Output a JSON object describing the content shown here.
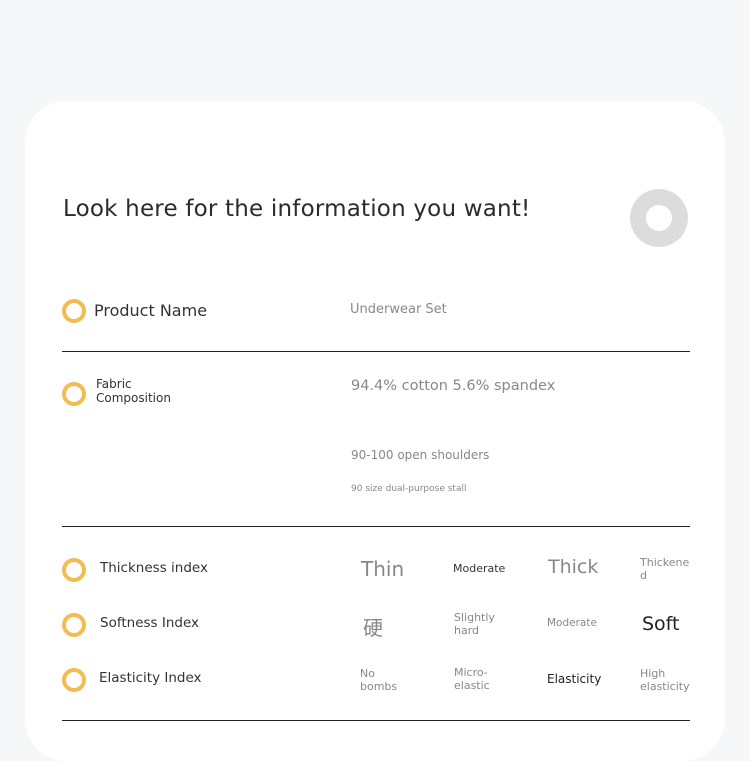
{
  "headline": "Look here for the information you want!",
  "rows": {
    "product_name": {
      "label": "Product Name",
      "value": "Underwear Set"
    },
    "fabric": {
      "label_line1": "Fabric",
      "label_line2": "Composition",
      "value": "94.4% cotton 5.6% spandex",
      "size_line": "90-100 open shoulders",
      "size_note": "90 size dual-purpose stall"
    }
  },
  "indices": {
    "thickness": {
      "label": "Thickness index",
      "levels": {
        "l1": "Thin",
        "l2": "Moderate",
        "l3": "Thick",
        "l4a": "Thickene",
        "l4b": "d"
      }
    },
    "softness": {
      "label": "Softness Index",
      "levels": {
        "l1": "硬",
        "l2a": "Slightly",
        "l2b": "hard",
        "l3": "Moderate",
        "l4": "Soft"
      }
    },
    "elasticity": {
      "label": "Elasticity Index",
      "levels": {
        "l1a": "No",
        "l1b": "bombs",
        "l2a": "Micro-",
        "l2b": "elastic",
        "l3": "Elasticity",
        "l4a": "High",
        "l4b": "elasticity"
      }
    }
  },
  "colors": {
    "accent": "#f2bc4e",
    "divider": "#222222",
    "muted": "#888888"
  }
}
